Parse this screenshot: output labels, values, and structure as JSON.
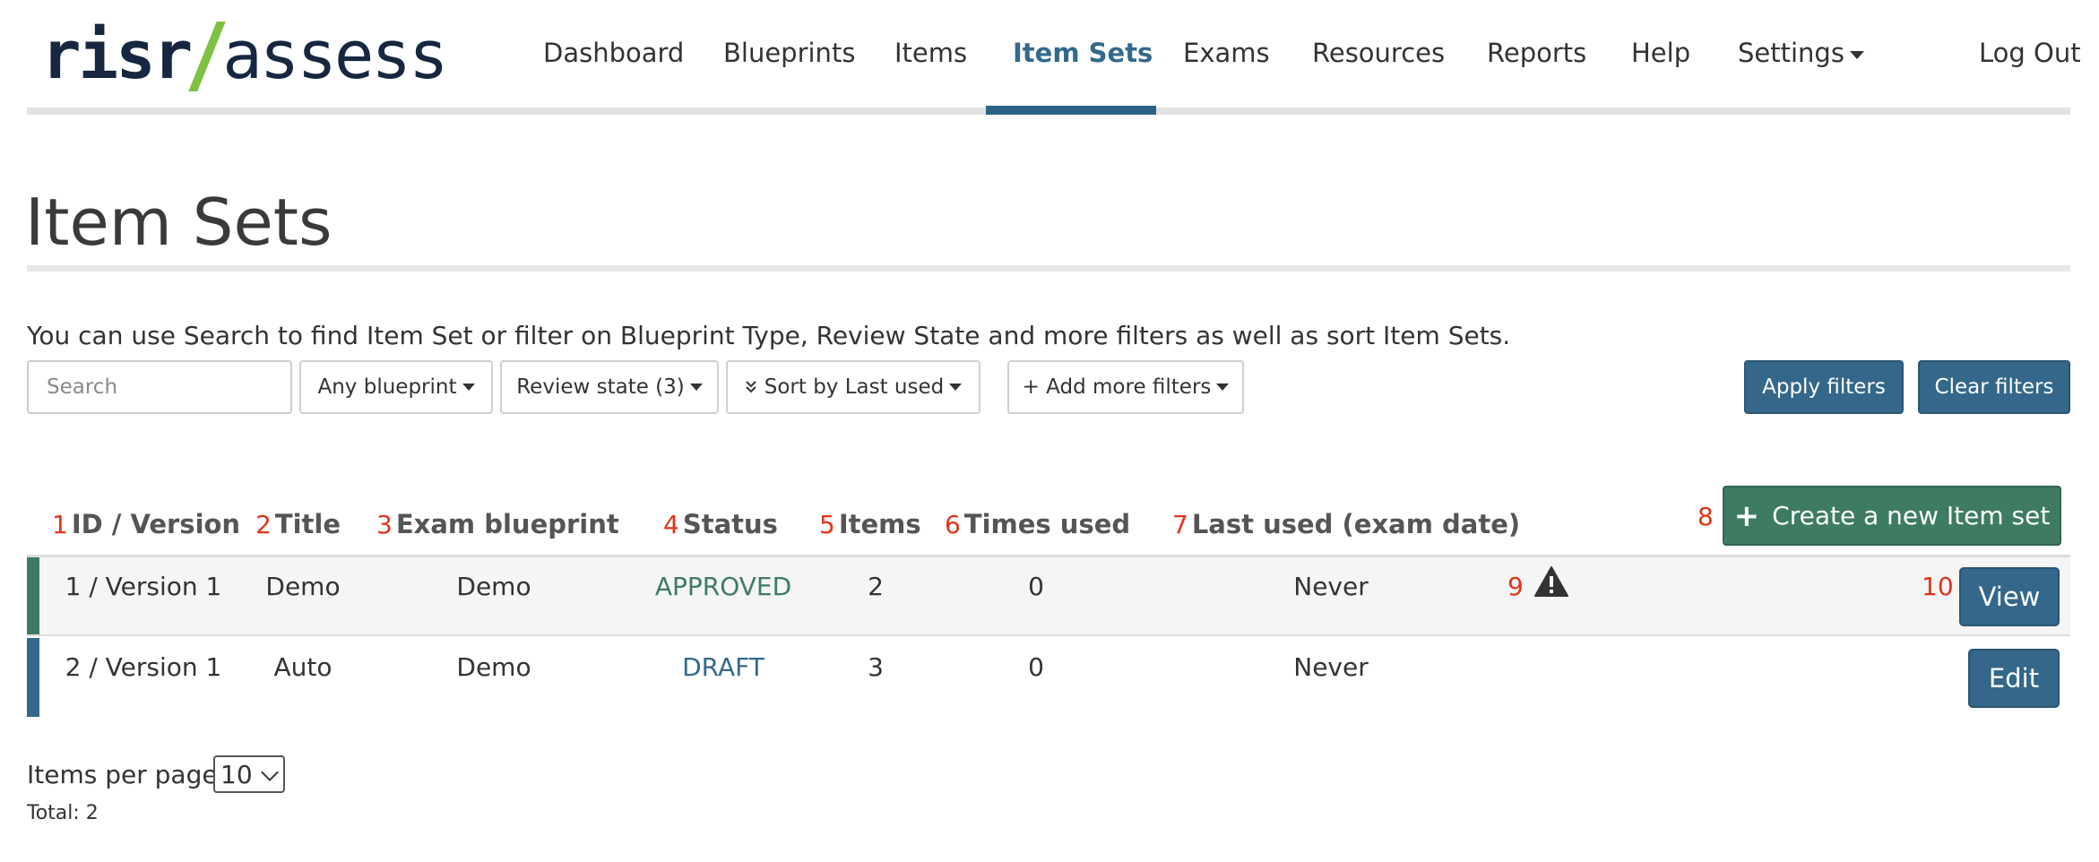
{
  "logo": {
    "part1": "risr",
    "part2": "assess",
    "slash_color": "#7ec142",
    "text_color": "#16273f"
  },
  "nav": {
    "items": [
      {
        "label": "Dashboard"
      },
      {
        "label": "Blueprints"
      },
      {
        "label": "Items"
      },
      {
        "label": "Item Sets",
        "active": true
      },
      {
        "label": "Exams"
      },
      {
        "label": "Resources"
      },
      {
        "label": "Reports"
      },
      {
        "label": "Help"
      },
      {
        "label": "Settings",
        "dropdown": true
      }
    ],
    "logout": "Log Out",
    "accent_color": "#2e6285"
  },
  "page": {
    "title": "Item Sets",
    "help_text": "You can use Search to find Item Set or filter on Blueprint Type, Review State and more filters as well as sort Item Sets."
  },
  "filters": {
    "search_placeholder": "Search",
    "blueprint": "Any blueprint",
    "review_state": "Review state (3)",
    "sort": "Sort by Last used",
    "sort_icon": "double-chevron-down-icon",
    "more_filters": "+ Add more filters",
    "apply": "Apply filters",
    "clear": "Clear filters"
  },
  "table": {
    "columns": [
      {
        "num": "1",
        "label": "ID / Version"
      },
      {
        "num": "2",
        "label": "Title"
      },
      {
        "num": "3",
        "label": "Exam blueprint"
      },
      {
        "num": "4",
        "label": "Status"
      },
      {
        "num": "5",
        "label": "Items"
      },
      {
        "num": "6",
        "label": "Times used"
      },
      {
        "num": "7",
        "label": "Last used (exam date)"
      }
    ],
    "create": {
      "num": "8",
      "label": "Create a new Item set",
      "icon": "plus-icon",
      "color": "#3e7b63"
    },
    "rows": [
      {
        "id_version": "1 / Version 1",
        "title": "Demo",
        "blueprint": "Demo",
        "status": "APPROVED",
        "items": "2",
        "times_used": "0",
        "last_used": "Never",
        "warning_num": "9",
        "warning_icon": "warning-triangle-icon",
        "action_num": "10",
        "action": "View",
        "accent": "#3e7b63"
      },
      {
        "id_version": "2 / Version 1",
        "title": "Auto",
        "blueprint": "Demo",
        "status": "DRAFT",
        "items": "3",
        "times_used": "0",
        "last_used": "Never",
        "action": "Edit",
        "accent": "#346789"
      }
    ]
  },
  "footer": {
    "per_page_label": "Items per page:",
    "per_page_value": "10",
    "total": "Total: 2"
  }
}
